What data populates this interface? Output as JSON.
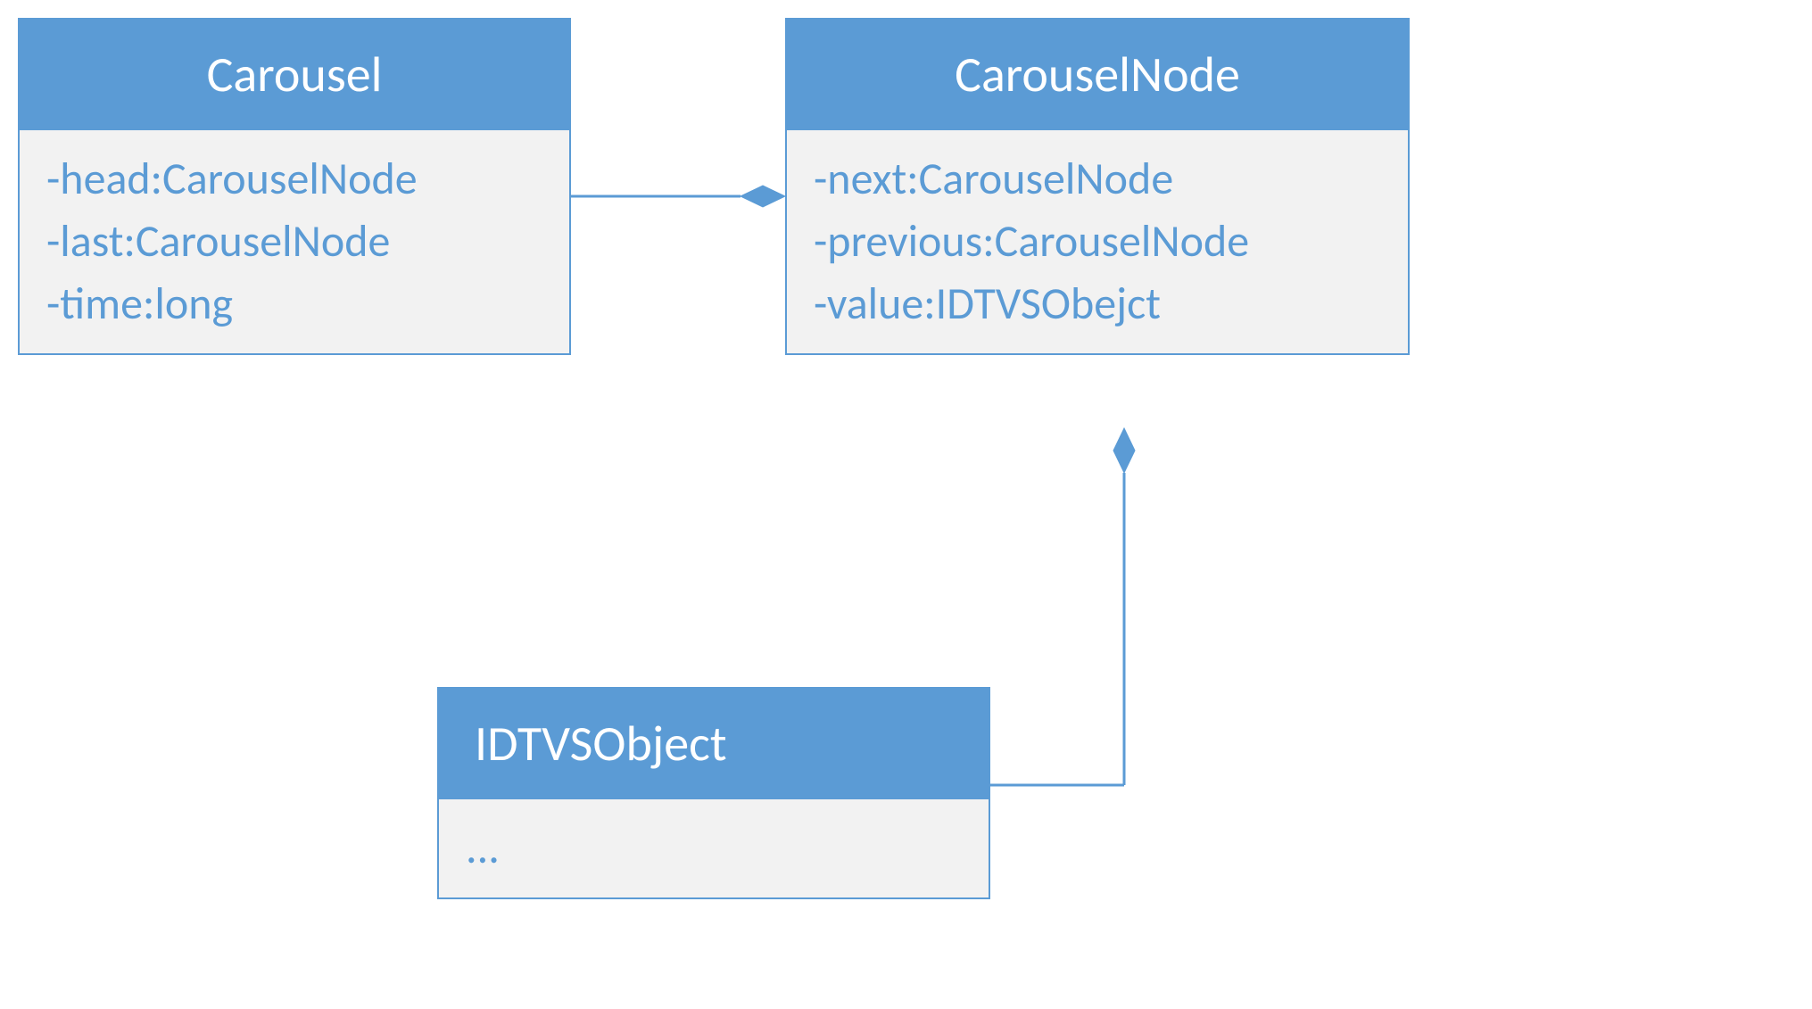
{
  "classes": {
    "carousel": {
      "name": "Carousel",
      "attributes": [
        "-head:CarouselNode",
        "-last:CarouselNode",
        "-time:long"
      ]
    },
    "carouselNode": {
      "name": "CarouselNode",
      "attributes": [
        "-next:CarouselNode",
        "-previous:CarouselNode",
        "-value:IDTVSObejct"
      ]
    },
    "idtvsObject": {
      "name": "IDTVSObject",
      "attributes": [
        "..."
      ]
    }
  }
}
